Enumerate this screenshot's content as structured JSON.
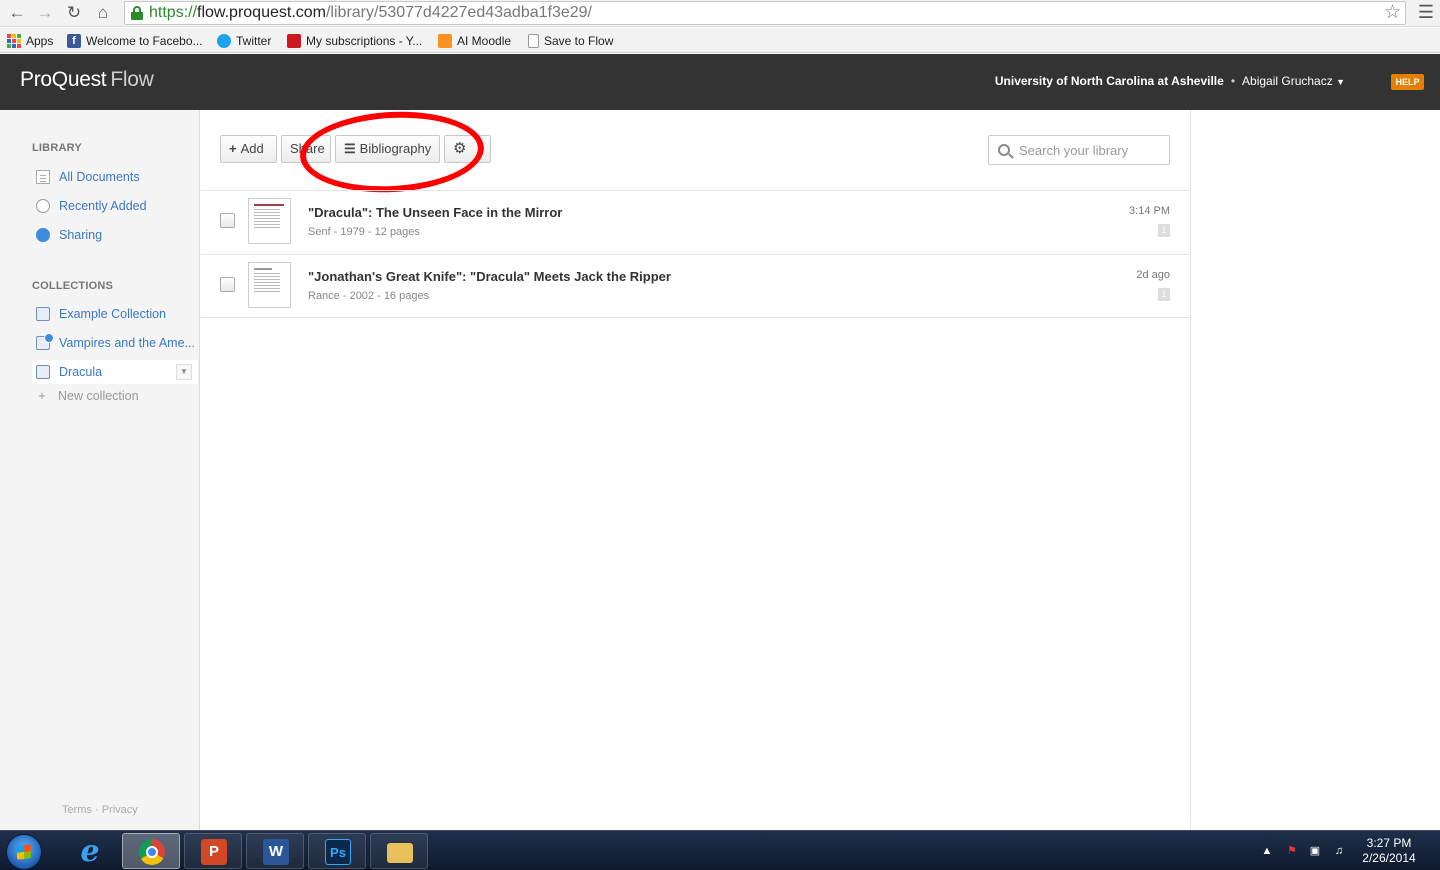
{
  "browser": {
    "url_scheme": "https://",
    "url_host": "flow.proquest.com",
    "url_path": "/library/53077d4227ed43adba1f3e29/"
  },
  "bookmarks": [
    {
      "label": "Apps"
    },
    {
      "label": "Welcome to Facebo..."
    },
    {
      "label": "Twitter"
    },
    {
      "label": "My subscriptions - Y..."
    },
    {
      "label": "AI Moodle"
    },
    {
      "label": "Save to Flow"
    }
  ],
  "header": {
    "brand": "ProQuest",
    "product": "Flow",
    "institution": "University of North Carolina at Asheville",
    "separator": "•",
    "user": "Abigail Gruchacz",
    "help": "HELP"
  },
  "sidebar": {
    "library_title": "LIBRARY",
    "library_items": [
      {
        "label": "All Documents"
      },
      {
        "label": "Recently Added"
      },
      {
        "label": "Sharing"
      }
    ],
    "collections_title": "COLLECTIONS",
    "collections": [
      {
        "label": "Example Collection"
      },
      {
        "label": "Vampires and the Ame..."
      },
      {
        "label": "Dracula"
      }
    ],
    "new_collection": "New collection",
    "footer": "Terms · Privacy"
  },
  "toolbar": {
    "add": "Add",
    "share": "Share",
    "bibliography": "Bibliography",
    "search_placeholder": "Search your library"
  },
  "documents": [
    {
      "title": "\"Dracula\": The Unseen Face in the Mirror",
      "meta": "Senf - 1979 - 12 pages",
      "time": "3:14 PM",
      "count": "1"
    },
    {
      "title": "\"Jonathan's Great Knife\": \"Dracula\" Meets Jack the Ripper",
      "meta": "Rance - 2002 - 16 pages",
      "time": "2d ago",
      "count": "1"
    }
  ],
  "taskbar": {
    "time": "3:27 PM",
    "date": "2/26/2014",
    "apps": [
      {
        "icon": "ie-icon"
      },
      {
        "icon": "chrome-icon"
      },
      {
        "icon": "powerpoint-icon",
        "glyph": "P"
      },
      {
        "icon": "word-icon",
        "glyph": "W"
      },
      {
        "icon": "photoshop-icon",
        "glyph": "Ps"
      },
      {
        "icon": "file-explorer-icon"
      }
    ]
  },
  "colors": {
    "header_bg": "#333333",
    "link": "#3a78c3",
    "help": "#e67e00",
    "annotation": "#ff0000"
  }
}
